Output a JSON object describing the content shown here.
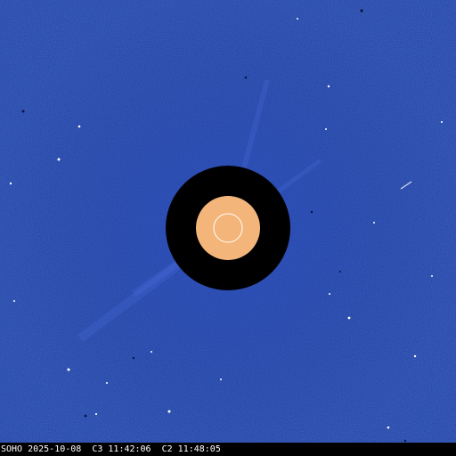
{
  "image": {
    "kind": "SOHO LASCO coronagraph composite",
    "background_color": "#1f3fa6",
    "occulter_color": "#000000",
    "sun_disk_color": "#f4b57a",
    "sun_outline_color": "#ffffff"
  },
  "caption": {
    "text": "SOHO 2025-10-08  C3 11:42:06  C2 11:48:05"
  }
}
